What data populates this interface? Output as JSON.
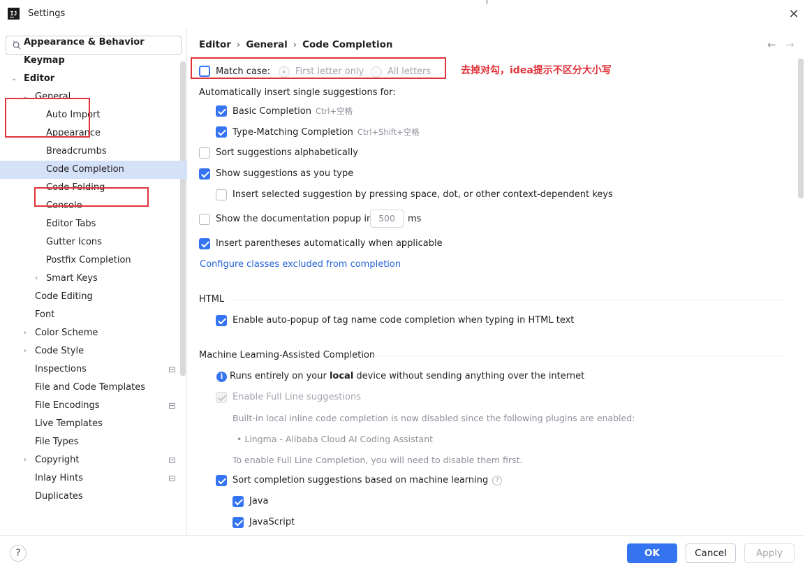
{
  "window": {
    "title": "Settings",
    "logo_text": "IJ",
    "close_icon": "×"
  },
  "search": {
    "placeholder": "",
    "value": ""
  },
  "sidebar": {
    "items": [
      {
        "label": "Appearance & Behavior",
        "chevron": "›"
      },
      {
        "label": "Keymap",
        "chevron": ""
      },
      {
        "label": "Editor",
        "chevron": "⌄"
      },
      {
        "label": "General",
        "chevron": "⌄"
      },
      {
        "label": "Auto Import",
        "chevron": ""
      },
      {
        "label": "Appearance",
        "chevron": ""
      },
      {
        "label": "Breadcrumbs",
        "chevron": ""
      },
      {
        "label": "Code Completion",
        "chevron": ""
      },
      {
        "label": "Code Folding",
        "chevron": ""
      },
      {
        "label": "Console",
        "chevron": ""
      },
      {
        "label": "Editor Tabs",
        "chevron": ""
      },
      {
        "label": "Gutter Icons",
        "chevron": ""
      },
      {
        "label": "Postfix Completion",
        "chevron": ""
      },
      {
        "label": "Smart Keys",
        "chevron": "›"
      },
      {
        "label": "Code Editing",
        "chevron": ""
      },
      {
        "label": "Font",
        "chevron": ""
      },
      {
        "label": "Color Scheme",
        "chevron": "›"
      },
      {
        "label": "Code Style",
        "chevron": "›"
      },
      {
        "label": "Inspections",
        "chevron": ""
      },
      {
        "label": "File and Code Templates",
        "chevron": ""
      },
      {
        "label": "File Encodings",
        "chevron": ""
      },
      {
        "label": "Live Templates",
        "chevron": ""
      },
      {
        "label": "File Types",
        "chevron": ""
      },
      {
        "label": "Copyright",
        "chevron": "›"
      },
      {
        "label": "Inlay Hints",
        "chevron": ""
      },
      {
        "label": "Duplicates",
        "chevron": ""
      }
    ]
  },
  "breadcrumb": {
    "items": [
      "Editor",
      "General",
      "Code Completion"
    ],
    "separator": "›"
  },
  "nav": {
    "back": "←",
    "forward": "→"
  },
  "options": {
    "match_case": "Match case:",
    "first_letter_only": "First letter only",
    "all_letters": "All letters",
    "auto_insert_header": "Automatically insert single suggestions for:",
    "basic_completion": "Basic Completion",
    "basic_completion_shortcut": "Ctrl+空格",
    "type_matching": "Type-Matching Completion",
    "type_matching_shortcut": "Ctrl+Shift+空格",
    "sort_alpha": "Sort suggestions alphabetically",
    "show_as_you_type": "Show suggestions as you type",
    "insert_selected": "Insert selected suggestion by pressing space, dot, or other context-dependent keys",
    "show_doc_popup": "Show the documentation popup in",
    "doc_popup_ms_value": "500",
    "ms": "ms",
    "insert_parens": "Insert parentheses automatically when applicable",
    "configure_link": "Configure classes excluded from completion"
  },
  "html_section": {
    "title": "HTML",
    "auto_popup": "Enable auto-popup of tag name code completion when typing in HTML text"
  },
  "ml_section": {
    "title": "Machine Learning-Assisted Completion",
    "info_pre": "Runs entirely on your ",
    "info_bold": "local",
    "info_post": " device without sending anything over the internet",
    "full_line": "Enable Full Line suggestions",
    "disabled_note": "Built-in local inline code completion is now disabled since the following plugins are enabled:",
    "plugin": "• Lingma - Alibaba Cloud AI Coding Assistant",
    "enable_note": "To enable Full Line Completion, you will need to disable them first.",
    "sort_ml": "Sort completion suggestions based on machine learning",
    "java": "Java",
    "javascript": "JavaScript"
  },
  "annotation": "去掉对勾，idea提示不区分大小写",
  "footer": {
    "help": "?",
    "ok": "OK",
    "cancel": "Cancel",
    "apply": "Apply"
  },
  "colors": {
    "accent": "#3574f0",
    "selection": "#d5e1f7",
    "annotation_red": "#e0323a",
    "link": "#2764d8"
  }
}
